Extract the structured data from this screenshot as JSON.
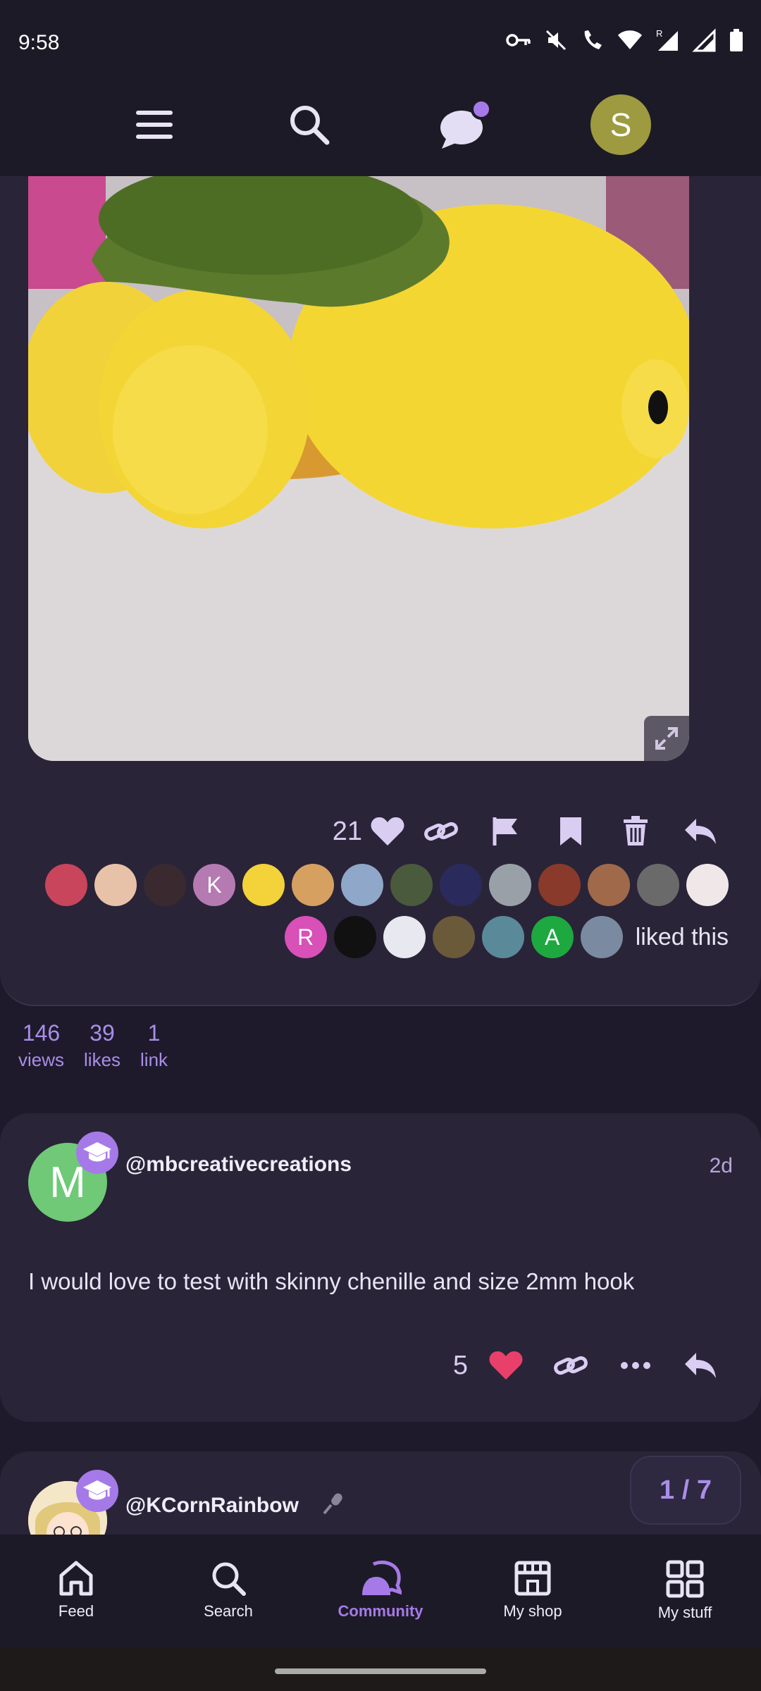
{
  "status_bar": {
    "time": "9:58"
  },
  "header": {
    "avatar_letter": "S",
    "notification_dot_color": "#a57ae8"
  },
  "post": {
    "like_count": "21",
    "liked_this": "liked this",
    "likers_row1_letters": [
      "",
      "",
      "",
      "K",
      "",
      "",
      "",
      "",
      "",
      "",
      "",
      "",
      "",
      ""
    ],
    "likers_row2_letters": [
      "R",
      "",
      "",
      "",
      "",
      "A",
      ""
    ]
  },
  "stats": [
    {
      "number": "146",
      "label": "views"
    },
    {
      "number": "39",
      "label": "likes"
    },
    {
      "number": "1",
      "label": "link"
    }
  ],
  "comments": [
    {
      "avatar_letter": "M",
      "username": "@mbcreativecreations",
      "time": "2d",
      "text": "I would love to test with skinny chenille and size 2mm hook",
      "like_count": "5"
    },
    {
      "username": "@KCornRainbow"
    }
  ],
  "pager": "1 / 7",
  "bottom_nav": [
    {
      "label": "Feed",
      "icon": "home-icon"
    },
    {
      "label": "Search",
      "icon": "search-icon"
    },
    {
      "label": "Community",
      "icon": "community-icon",
      "active": true
    },
    {
      "label": "My shop",
      "icon": "shop-icon"
    },
    {
      "label": "My stuff",
      "icon": "grid-icon"
    }
  ],
  "colors": {
    "accent": "#a57ae8",
    "heart_red": "#e8406a",
    "background": "#1e1a2c",
    "card": "#2a2438"
  }
}
